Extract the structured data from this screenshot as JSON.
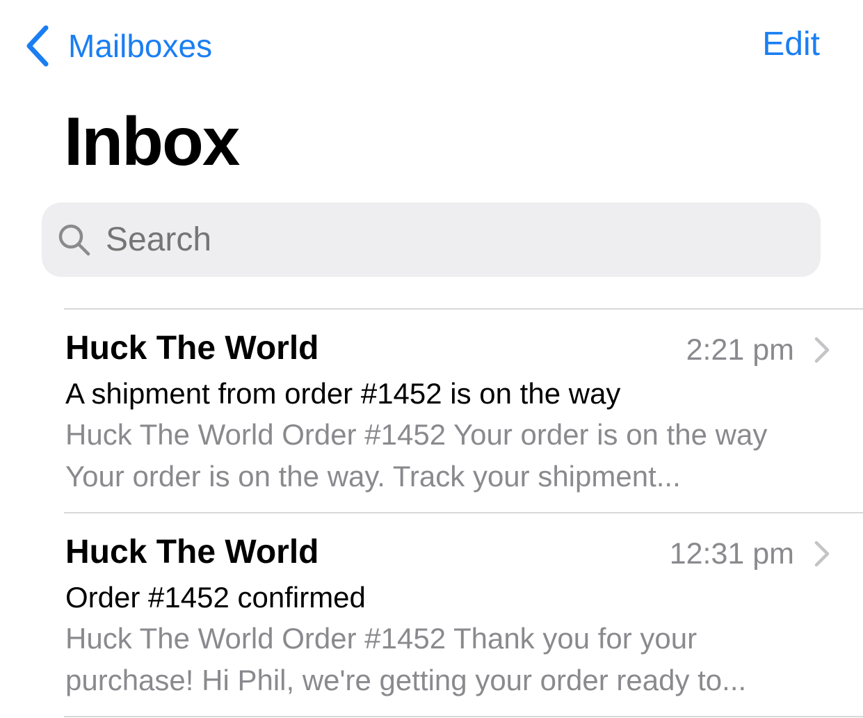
{
  "nav": {
    "back_label": "Mailboxes",
    "edit_label": "Edit",
    "back_icon": "chevron-left-icon"
  },
  "page": {
    "title": "Inbox"
  },
  "search": {
    "placeholder": "Search",
    "icon": "search-icon"
  },
  "colors": {
    "accent": "#1a7ef2",
    "secondary_text": "#8a8a8e",
    "search_bg": "#eeeef0",
    "divider": "#d8d8db"
  },
  "messages": [
    {
      "sender": "Huck The World",
      "time": "2:21 pm",
      "subject": "A shipment from order #1452 is on the way",
      "preview": "Huck The World Order #1452 Your order is on the way Your order is on the way. Track your shipment..."
    },
    {
      "sender": "Huck The World",
      "time": "12:31 pm",
      "subject": "Order #1452 confirmed",
      "preview": "Huck The World Order #1452 Thank you for your purchase! Hi Phil, we're getting your order ready to..."
    }
  ]
}
